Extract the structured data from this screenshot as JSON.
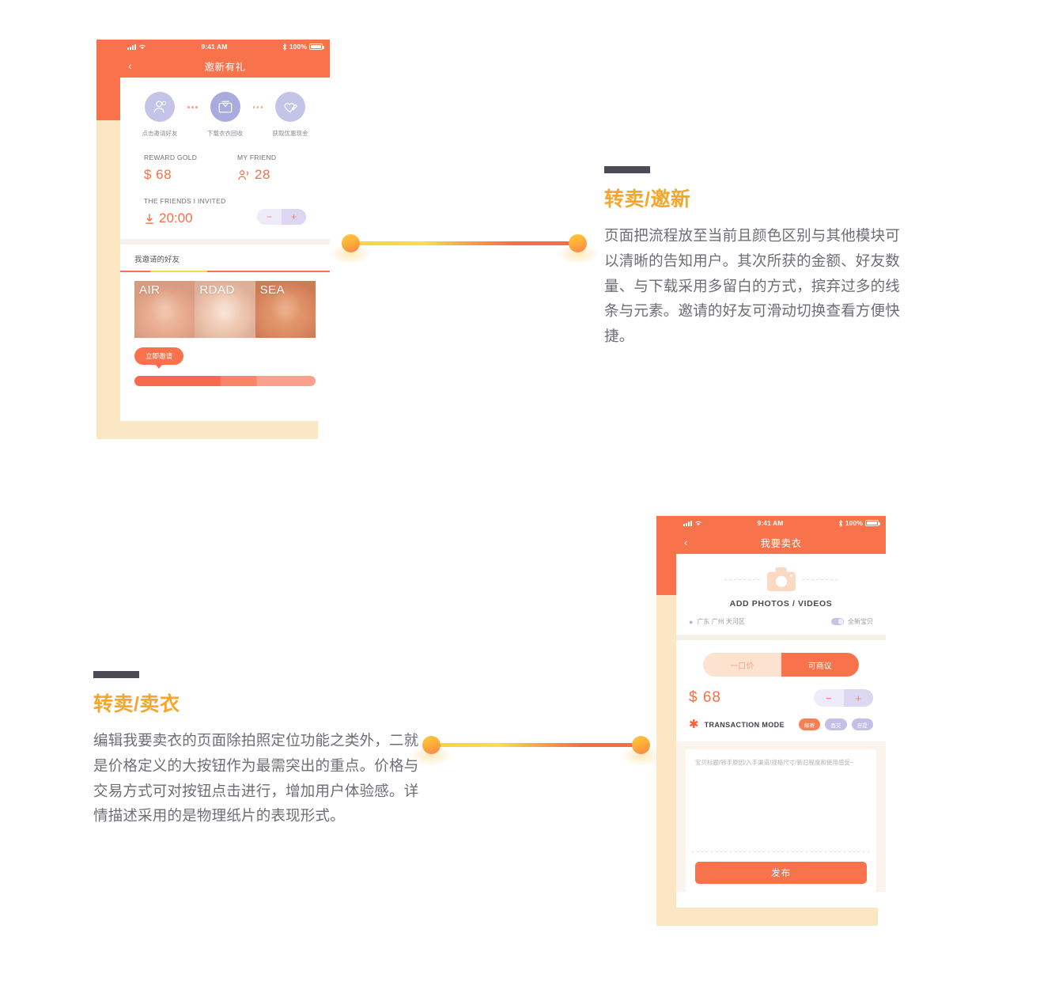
{
  "phone1": {
    "status_bar": {
      "time": "9:41 AM",
      "battery": "100%",
      "signal_icon": "cellular-bars-icon",
      "wifi_icon": "wifi-icon",
      "bluetooth_icon": "bluetooth-icon"
    },
    "nav": {
      "back_icon": "chevron-left-icon",
      "title": "邀新有礼"
    },
    "steps": [
      {
        "label": "点击邀请好友",
        "icon": "users-icon",
        "active": false
      },
      {
        "label": "下载衣衣回收",
        "icon": "clothes-box-icon",
        "active": true
      },
      {
        "label": "获取优惠现金",
        "icon": "heart-pen-icon",
        "active": false
      }
    ],
    "stats": [
      {
        "key": "REWARD GOLD",
        "value": "$ 68",
        "icon": "dollar-icon"
      },
      {
        "key": "MY FRIEND",
        "value": "28",
        "icon": "friends-icon"
      }
    ],
    "invited": {
      "key": "THE FRIENDS I INVITED",
      "value": "20:00",
      "icon": "download-icon"
    },
    "stepper": {
      "minus": "−",
      "plus": "+"
    },
    "section_title": "我邀请的好友",
    "friends": [
      {
        "name": "AIR"
      },
      {
        "name": "RDAD"
      },
      {
        "name": "SEA"
      }
    ],
    "invite_button": "立即邀请"
  },
  "phone2": {
    "status_bar": {
      "time": "9:41 AM",
      "battery": "100%",
      "signal_icon": "cellular-bars-icon",
      "wifi_icon": "wifi-icon",
      "bluetooth_icon": "bluetooth-icon"
    },
    "nav": {
      "back_icon": "chevron-left-icon",
      "title": "我要卖衣"
    },
    "photo": {
      "icon": "camera-icon",
      "label": "ADD PHOTOS / VIDEOS"
    },
    "location": {
      "icon": "location-pin-icon",
      "text": "广东 广州 天河区"
    },
    "condition": {
      "toggle_icon": "toggle-switch-icon",
      "text": "全新宝贝"
    },
    "price_tabs": [
      {
        "label": "一口价",
        "active": false
      },
      {
        "label": "可商议",
        "active": true
      }
    ],
    "price": "$ 68",
    "stepper": {
      "minus": "−",
      "plus": "+"
    },
    "transaction": {
      "star_icon": "star-icon",
      "label": "TRANSACTION MODE",
      "chips": [
        {
          "label": "邮寄",
          "active": true
        },
        {
          "label": "面交",
          "active": false
        },
        {
          "label": "自提",
          "active": false
        }
      ]
    },
    "description_placeholder": "宝贝标题/转手原因/入手渠道/规格尺寸/新旧程度和使用感受~",
    "publish_button": "发布"
  },
  "block1": {
    "heading": "转卖/邀新",
    "body": "页面把流程放至当前且颜色区别与其他模块可以清晰的告知用户。其次所获的金额、好友数量、与下载采用多留白的方式，摈弃过多的线条与元素。邀请的好友可滑动切换查看方便快捷。"
  },
  "block2": {
    "heading": "转卖/卖衣",
    "body": "编辑我要卖衣的页面除拍照定位功能之类外，二就是价格定义的大按钮作为最需突出的重点。价格与交易方式可对按钮点击进行，增加用户体验感。详情描述采用的是物理纸片的表现形式。"
  },
  "colors": {
    "brand_orange": "#F8724C",
    "heading_amber": "#F6A72A",
    "kicker_dark": "#4B4B55",
    "backdrop_cream": "#FBE7C4",
    "lavender": "#C3C4E8",
    "body_gray": "#6D6D75"
  }
}
